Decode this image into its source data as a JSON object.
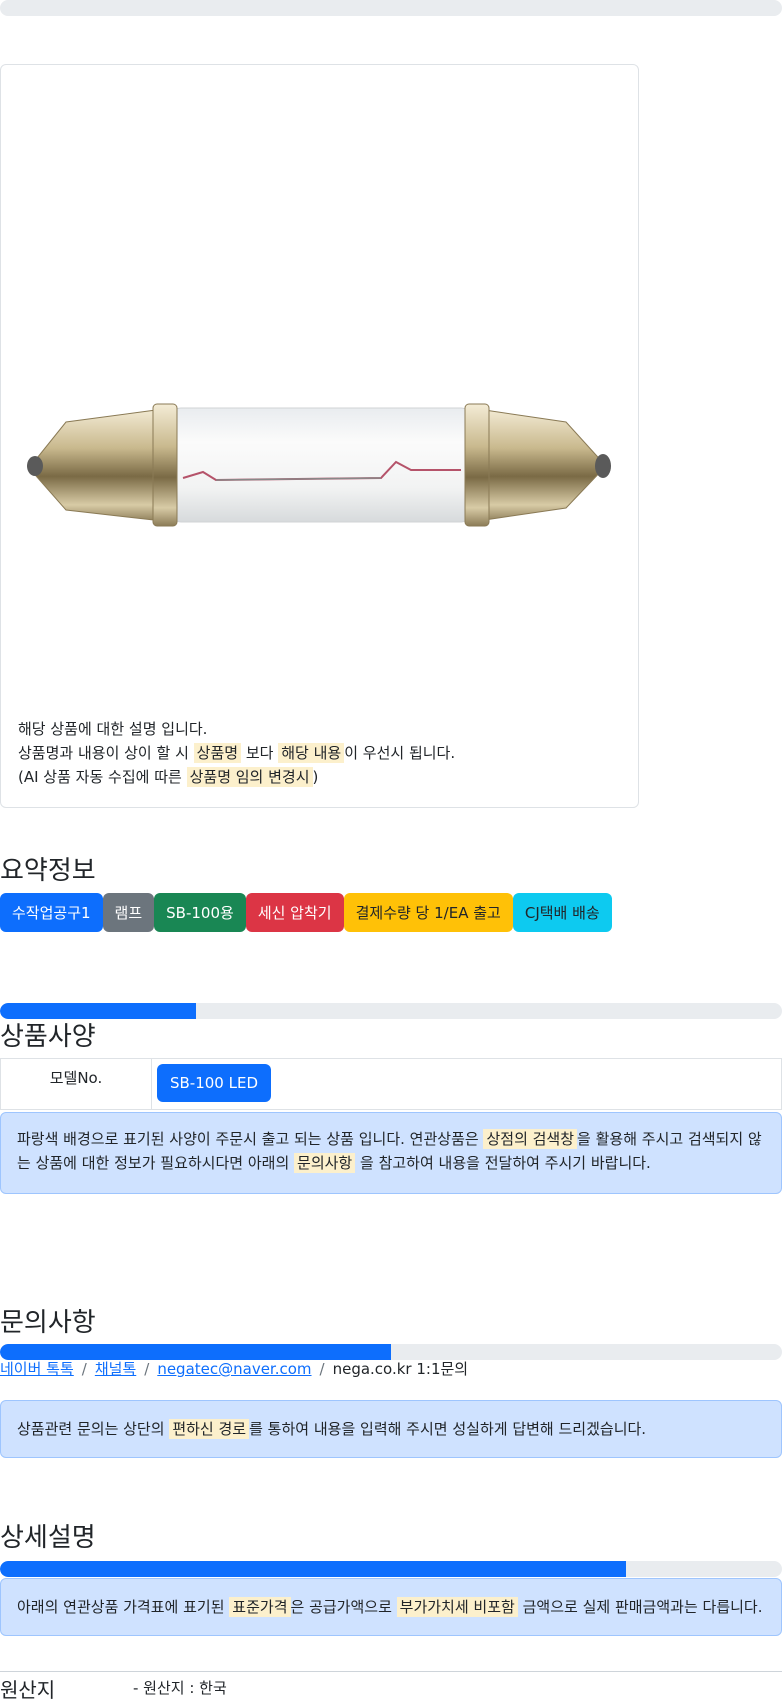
{
  "product_card": {
    "image_alt": "bulb-photo",
    "caption": {
      "line1": "해당 상품에 대한 설명 입니다.",
      "line2_a": "상품명과 내용이 상이 할 시",
      "line2_mark1": "상품명",
      "line2_b": "보다",
      "line2_mark2": "해당 내용",
      "line2_c": "이 우선시 됩니다.",
      "line3_a": "(AI 상품 자동 수집에 따른",
      "line3_mark": "상품명 임의 변경시",
      "line3_b": ")"
    }
  },
  "summary": {
    "title": "요약정보",
    "badges": [
      {
        "label": "수작업공구1",
        "bg": "#0d6efd",
        "fg": "#ffffff"
      },
      {
        "label": "램프",
        "bg": "#6c757d",
        "fg": "#ffffff"
      },
      {
        "label": "SB-100용",
        "bg": "#198754",
        "fg": "#ffffff"
      },
      {
        "label": "세신 압착기",
        "bg": "#dc3545",
        "fg": "#ffffff"
      },
      {
        "label": "결제수량 당 1/EA 출고",
        "bg": "#ffc107",
        "fg": "#212529"
      },
      {
        "label": "CJ택배 배송",
        "bg": "#0dcaf0",
        "fg": "#212529"
      }
    ]
  },
  "progress": {
    "p1": 0.25,
    "p2": 0.5,
    "p3": 0.8
  },
  "spec": {
    "title": "상품사양",
    "row_label": "모델No.",
    "row_value": "SB-100 LED",
    "alert": {
      "a": "파랑색 배경으로 표기된 사양이 주문시 출고 되는 상품 입니다. 연관상품은",
      "mark1": "상점의 검색창",
      "b": "을 활용해 주시고 검색되지 않는 상품에 대한 정보가 필요하시다면 아래의",
      "mark2": "문의사항",
      "c": "을 참고하여 내용을 전달하여 주시기 바랍니다."
    }
  },
  "inquiry": {
    "title": "문의사항",
    "links": [
      "네이버 톡톡",
      "채널톡",
      "negatec@naver.com"
    ],
    "last": "nega.co.kr 1:1문의",
    "sep": "/",
    "alert": {
      "a": "상품관련 문의는 상단의",
      "mark": "편하신 경로",
      "b": "를 통하여 내용을 입력해 주시면 성실하게 답변해 드리겠습니다."
    }
  },
  "detail": {
    "title": "상세설명",
    "alert": {
      "a": "아래의 연관상품 가격표에 표기된",
      "mark1": "표준가격",
      "b": "은 공급가액으로",
      "mark2": "부가가치세 비포함",
      "c": "금액으로 실제 판매금액과는 다릅니다."
    }
  },
  "origin": {
    "label": "원산지",
    "value": "- 원산지 : 한국"
  }
}
